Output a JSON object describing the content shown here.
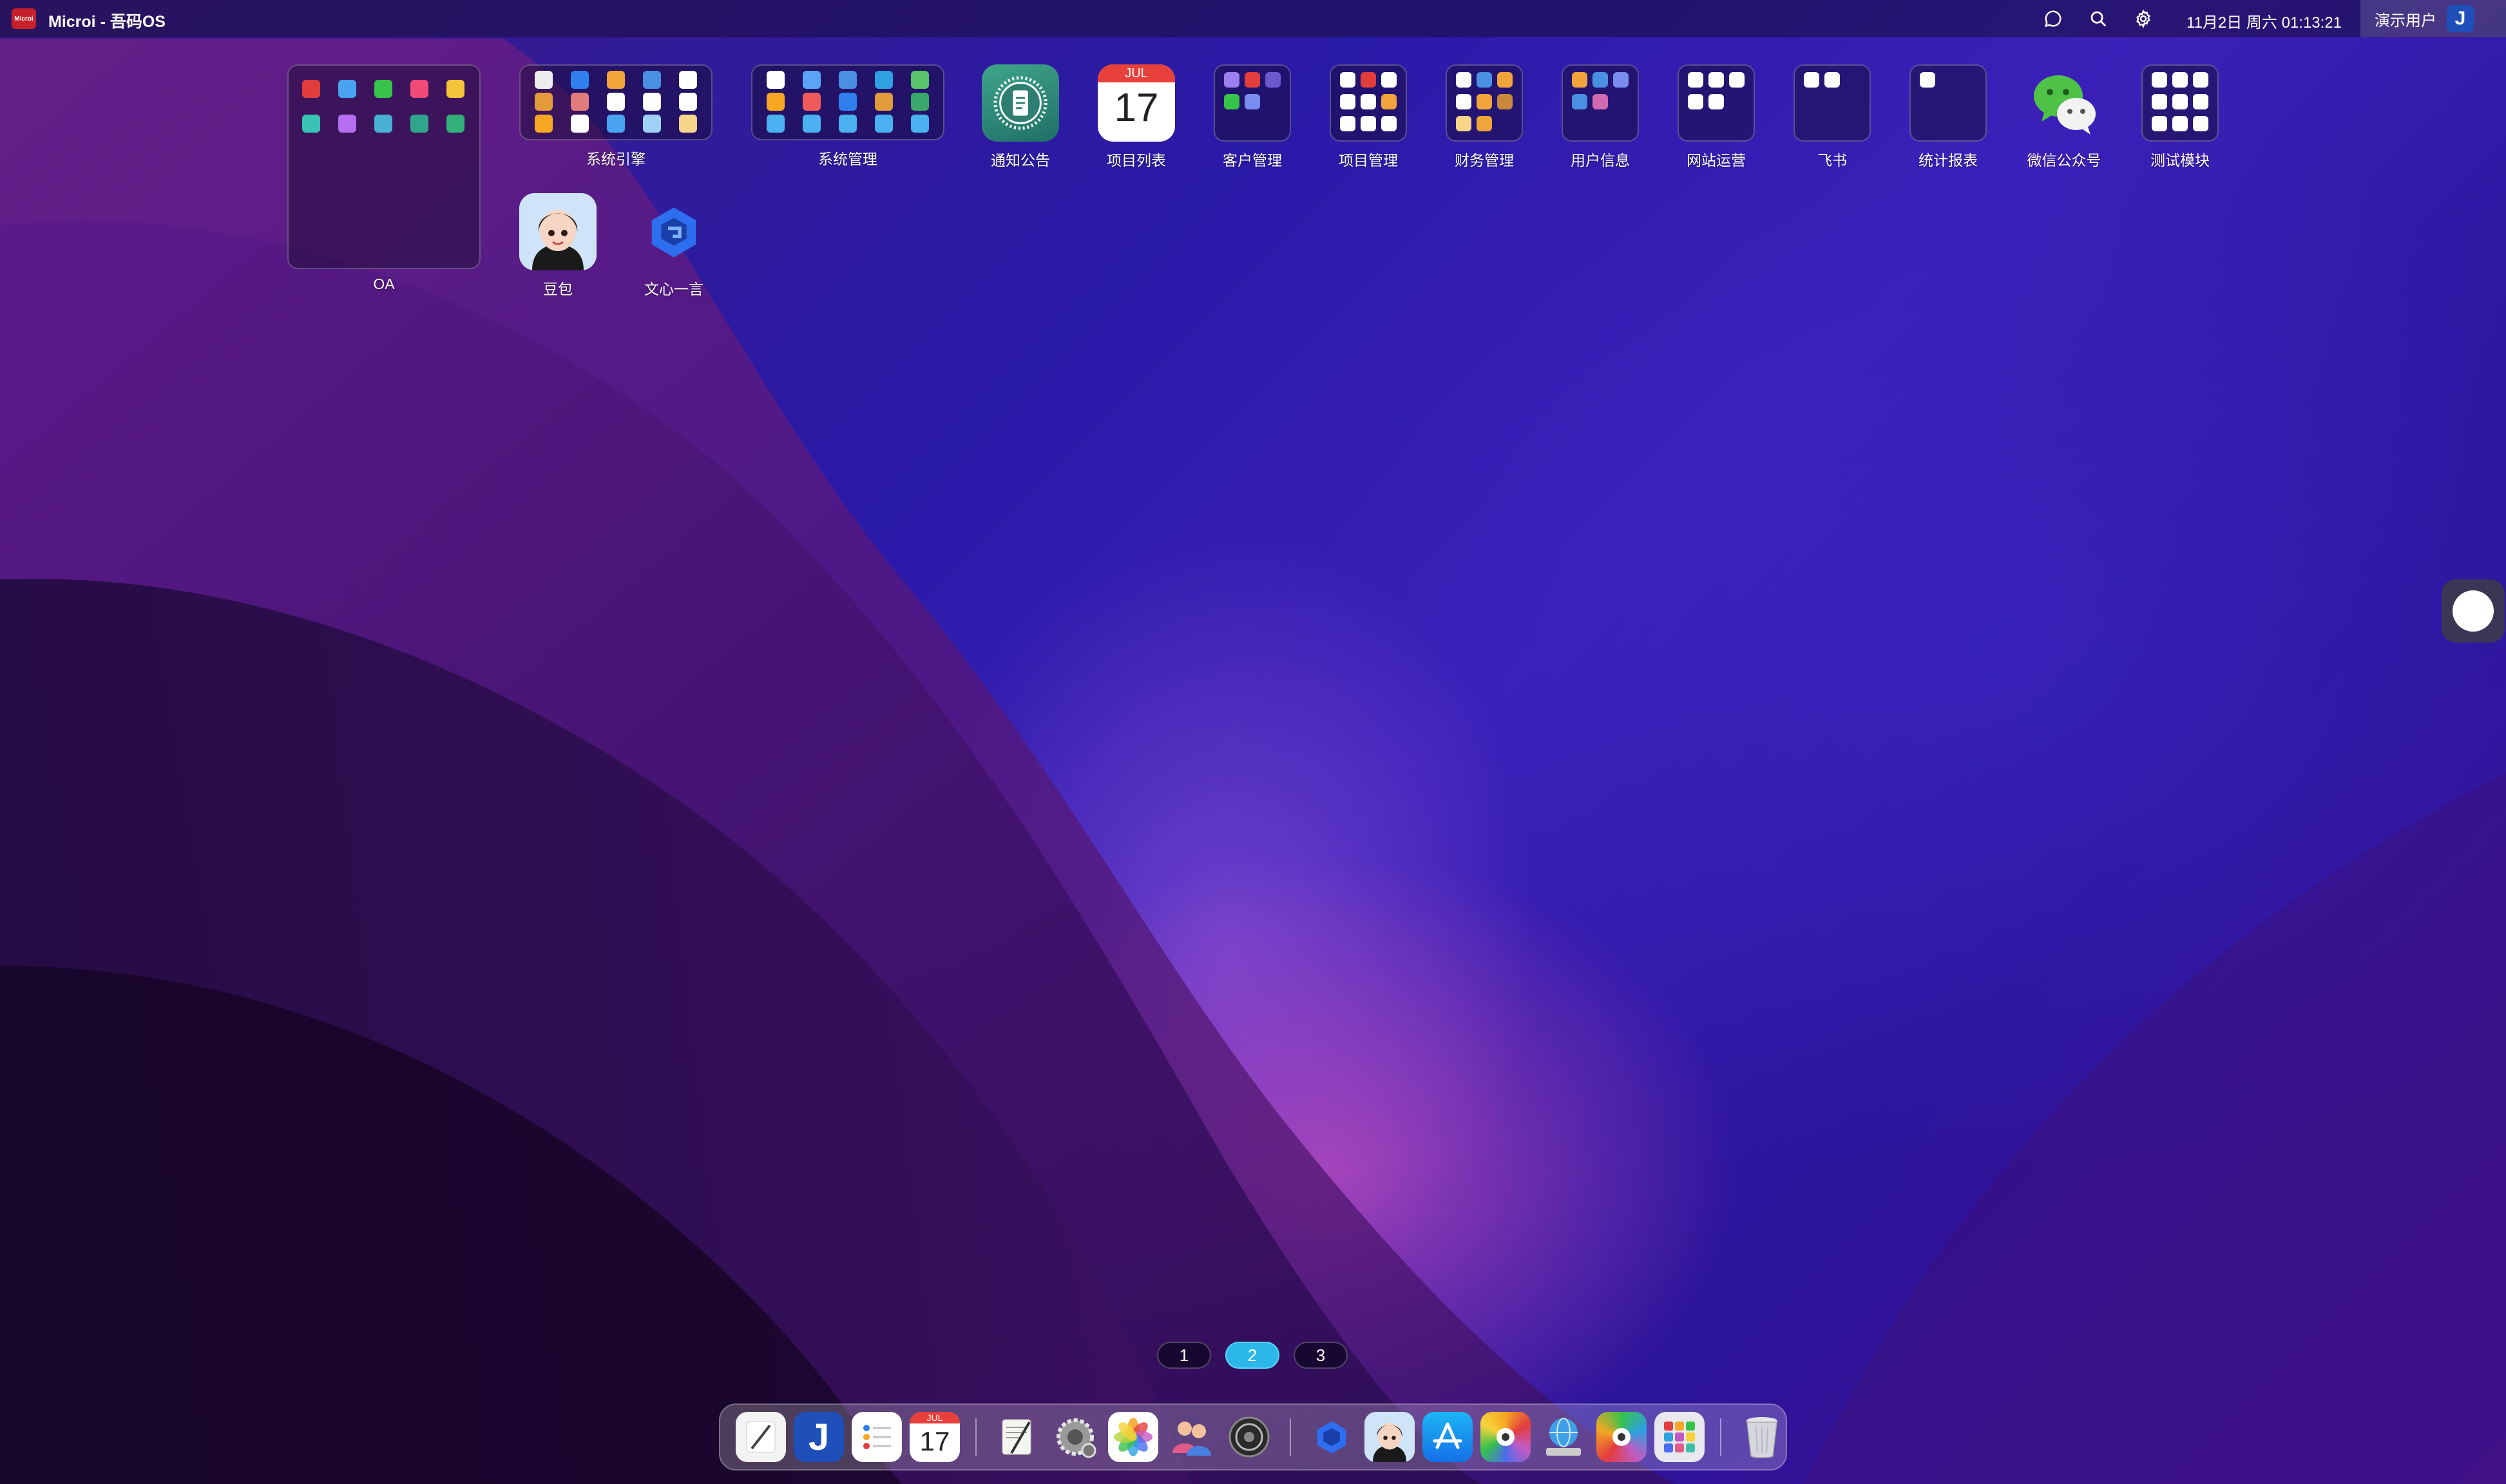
{
  "menubar": {
    "logo_text": "Microi",
    "app_title": "Microi - 吾码OS",
    "clock": "11月2日 周六 01:13:21",
    "user_name": "演示用户",
    "user_avatar_glyph": "J",
    "icons": [
      "chat-icon",
      "search-icon",
      "gear-icon"
    ]
  },
  "desktop": {
    "folders": [
      {
        "label": "OA",
        "mini_colors": [
          "#e23d3d",
          "#4aa3f0",
          "#37c24a",
          "#f04a76",
          "#f5c33a",
          "#39c3b5",
          "#b56ef0",
          "#4ab0d6",
          "#2fa68c",
          "#31b07a"
        ]
      },
      {
        "label": "系统引擎",
        "mini_colors": [
          "#eeeeee",
          "#2f80ed",
          "#f0a43a",
          "#4a90e2",
          "#ffffff",
          "#e59a3a",
          "#e27b7b",
          "#ffffff",
          "#ffffff",
          "#ffffff",
          "#f5a623",
          "#ffffff",
          "#4aa3f0",
          "#9fd0f5",
          "#f7d48a"
        ]
      },
      {
        "label": "系统管理",
        "mini_colors": [
          "#ffffff",
          "#5ba3f5",
          "#4a90e2",
          "#2fa0e0",
          "#58c46a",
          "#f5a623",
          "#f05a5a",
          "#2f80ed",
          "#e09b3a",
          "#3aa86a",
          "#4ab0f0",
          "#4ab0f0",
          "#4ab0f0",
          "#4ab0f0",
          "#4ab0f0"
        ]
      },
      {
        "label": "客户管理",
        "mini_colors": [
          "#9b7ef0",
          "#e23d3d",
          "#6a5acd",
          "#37c24a",
          "#7a8cf0"
        ]
      },
      {
        "label": "项目管理",
        "mini_colors": [
          "#ffffff",
          "#e23d3d",
          "#ffffff",
          "#ffffff",
          "#ffffff",
          "#f0a43a",
          "#ffffff",
          "#ffffff",
          "#ffffff"
        ]
      },
      {
        "label": "财务管理",
        "mini_colors": [
          "#ffffff",
          "#4a90e2",
          "#f0a43a",
          "#ffffff",
          "#f0a43a",
          "#c88a3a",
          "#f7d48a",
          "#f0a43a"
        ]
      },
      {
        "label": "用户信息",
        "mini_colors": [
          "#f0a43a",
          "#4a90e2",
          "#7a8cf0",
          "#4a90e2",
          "#d06ab0"
        ]
      },
      {
        "label": "网站运营",
        "mini_colors": [
          "#ffffff",
          "#ffffff",
          "#ffffff",
          "#ffffff",
          "#ffffff"
        ]
      },
      {
        "label": "飞书",
        "mini_colors": [
          "#ffffff",
          "#ffffff"
        ]
      },
      {
        "label": "统计报表",
        "mini_colors": [
          "#ffffff"
        ]
      },
      {
        "label": "测试模块",
        "mini_colors": [
          "#ffffff",
          "#ffffff",
          "#ffffff",
          "#ffffff",
          "#ffffff",
          "#ffffff",
          "#ffffff",
          "#ffffff",
          "#ffffff"
        ]
      }
    ],
    "apps": [
      {
        "label": "通知公告",
        "icon": "notice-icon"
      },
      {
        "label": "项目列表",
        "icon": "calendar-icon",
        "month": "JUL",
        "day": "17"
      },
      {
        "label": "微信公众号",
        "icon": "wechat-icon"
      },
      {
        "label": "豆包",
        "icon": "doubao-avatar-icon"
      },
      {
        "label": "文心一言",
        "icon": "wenxin-icon"
      }
    ]
  },
  "pager": {
    "pages": [
      "1",
      "2",
      "3"
    ],
    "active": "2"
  },
  "dock": {
    "items": [
      "notes-icon",
      "microi-app-icon",
      "reminders-icon",
      "calendar-icon",
      "separator",
      "textedit-icon",
      "system-settings-gear-icon",
      "photos-icon",
      "users-icon",
      "settings-dial-icon",
      "separator",
      "wenxin-icon",
      "doubao-icon",
      "app-store-icon",
      "grid-colorful-icon",
      "web-globe-icon",
      "grid-colorful-2-icon",
      "launchpad-icon",
      "separator",
      "trash-icon"
    ],
    "calendar_month": "JUL",
    "calendar_day": "17"
  },
  "assist_button": {
    "icon": "assistive-touch-icon"
  }
}
